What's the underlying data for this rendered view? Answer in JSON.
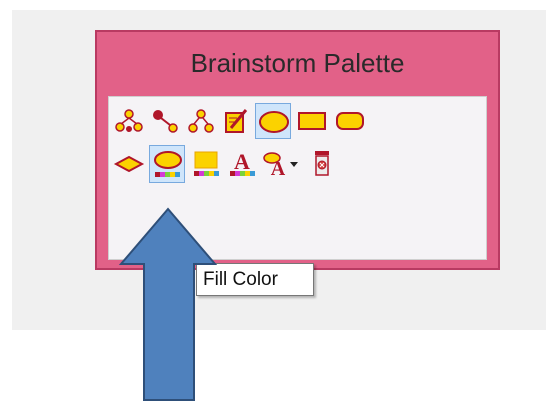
{
  "palette": {
    "title": "Brainstorm Palette"
  },
  "tooltip": {
    "text": "Fill Color"
  },
  "icons": {
    "row1": [
      "tree-icon",
      "connector-icon",
      "hierarchy-icon",
      "note-edit-icon",
      "oval-shape-icon",
      "rectangle-shape-icon",
      "rounded-rectangle-shape-icon"
    ],
    "row2": [
      "diamond-shape-icon",
      "fill-color-icon",
      "line-color-icon",
      "text-color-icon",
      "text-style-icon",
      "dropdown-arrow-icon",
      "delete-icon"
    ]
  },
  "colors": {
    "palette_bg": "#e26188",
    "shape_fill": "#fbd200",
    "shape_stroke": "#b0162a",
    "arrow_fill": "#4f81bd",
    "arrow_stroke": "#2e4f79"
  }
}
